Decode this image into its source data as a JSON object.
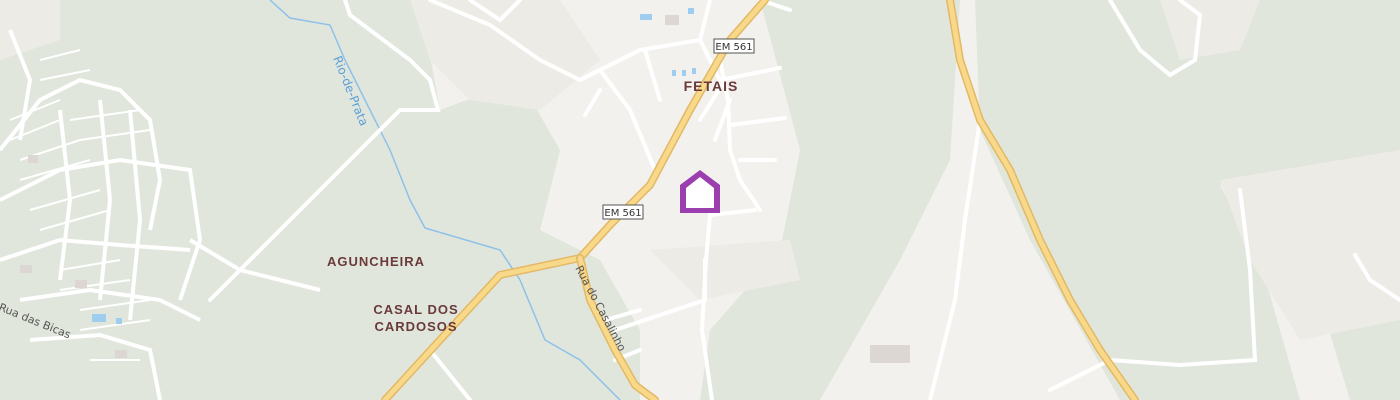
{
  "map": {
    "places": {
      "fetais": "FETAIS",
      "aguncheira": "AGUNCHEIRA",
      "casal_line1": "CASAL DOS",
      "casal_line2": "CARDOSOS"
    },
    "road_shields": {
      "top": "EM 561",
      "middle": "EM 561"
    },
    "street_labels": {
      "rua_do_casalinho": "Rua do Casalinho",
      "rua_das_bicas": "Rua das Bicas"
    },
    "river_label": "Rio-de-Prata",
    "marker": {
      "icon": "home-icon",
      "color": "#9b3fb0"
    },
    "colors": {
      "background": "#f3f1ed",
      "vegetation": "#e1e6dc",
      "main_road_fill": "#f8d98a",
      "main_road_casing": "#e3b865",
      "minor_road": "#ffffff",
      "river": "#8ec1ea",
      "label": "#6a3a3a"
    }
  }
}
